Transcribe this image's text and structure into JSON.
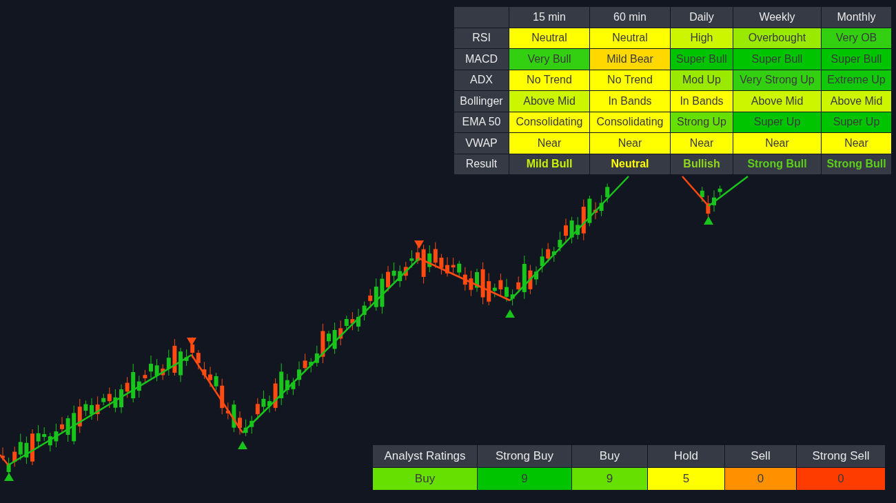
{
  "signal_table": {
    "columns": [
      "15 min",
      "60 min",
      "Daily",
      "Weekly",
      "Monthly"
    ],
    "rows": [
      {
        "label": "RSI",
        "cells": [
          {
            "text": "Neutral",
            "color": "#ffff00"
          },
          {
            "text": "Neutral",
            "color": "#ffff00"
          },
          {
            "text": "High",
            "color": "#ccf500"
          },
          {
            "text": "Overbought",
            "color": "#99ea00"
          },
          {
            "text": "Very OB",
            "color": "#33d011"
          }
        ]
      },
      {
        "label": "MACD",
        "cells": [
          {
            "text": "Very Bull",
            "color": "#33d011"
          },
          {
            "text": "Mild Bear",
            "color": "#ffd800"
          },
          {
            "text": "Super Bull",
            "color": "#00c400"
          },
          {
            "text": "Super Bull",
            "color": "#00c400"
          },
          {
            "text": "Super Bull",
            "color": "#00c400"
          }
        ]
      },
      {
        "label": "ADX",
        "cells": [
          {
            "text": "No Trend",
            "color": "#ffff00"
          },
          {
            "text": "No Trend",
            "color": "#ffff00"
          },
          {
            "text": "Mod Up",
            "color": "#99ea00"
          },
          {
            "text": "Very Strong Up",
            "color": "#33d011"
          },
          {
            "text": "Extreme Up",
            "color": "#11c80a"
          }
        ]
      },
      {
        "label": "Bollinger",
        "cells": [
          {
            "text": "Above Mid",
            "color": "#ccf500"
          },
          {
            "text": "In Bands",
            "color": "#ffff00"
          },
          {
            "text": "In Bands",
            "color": "#ffff00"
          },
          {
            "text": "Above Mid",
            "color": "#ccf500"
          },
          {
            "text": "Above Mid",
            "color": "#ccf500"
          }
        ]
      },
      {
        "label": "EMA 50",
        "cells": [
          {
            "text": "Consolidating",
            "color": "#ffff00"
          },
          {
            "text": "Consolidating",
            "color": "#ffff00"
          },
          {
            "text": "Strong Up",
            "color": "#66e000"
          },
          {
            "text": "Super Up",
            "color": "#00c400"
          },
          {
            "text": "Super Up",
            "color": "#00c400"
          }
        ]
      },
      {
        "label": "VWAP",
        "cells": [
          {
            "text": "Near",
            "color": "#ffff00"
          },
          {
            "text": "Near",
            "color": "#ffff00"
          },
          {
            "text": "Near",
            "color": "#ffff00"
          },
          {
            "text": "Near",
            "color": "#ffff00"
          },
          {
            "text": "Near",
            "color": "#ffff00"
          }
        ]
      }
    ],
    "result": {
      "label": "Result",
      "cells": [
        {
          "text": "Mild Bull",
          "color": "#c8f000"
        },
        {
          "text": "Neutral",
          "color": "#ffff00"
        },
        {
          "text": "Bullish",
          "color": "#8fd81e"
        },
        {
          "text": "Strong Bull",
          "color": "#5ccf1a"
        },
        {
          "text": "Strong Bull",
          "color": "#5ccf1a"
        }
      ]
    }
  },
  "analyst_ratings": {
    "title": "Analyst Ratings",
    "columns": [
      "Strong Buy",
      "Buy",
      "Hold",
      "Sell",
      "Strong Sell"
    ],
    "cells": [
      {
        "text": "Buy",
        "color": "#66e000"
      },
      {
        "text": "9",
        "color": "#00c400"
      },
      {
        "text": "9",
        "color": "#66e000"
      },
      {
        "text": "5",
        "color": "#ffff00"
      },
      {
        "text": "0",
        "color": "#ff9000"
      },
      {
        "text": "0",
        "color": "#ff3c00"
      }
    ]
  }
}
